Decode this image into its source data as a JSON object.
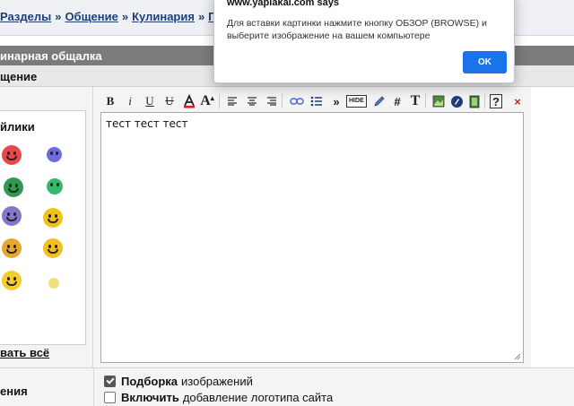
{
  "breadcrumb": [
    {
      "label": "Разделы"
    },
    {
      "label": "Общение"
    },
    {
      "label": "Кулинария"
    },
    {
      "label": "Г"
    }
  ],
  "breadcrumb_separator": "»",
  "forum_title": "инарная общалка",
  "section_title": "щение",
  "smiley_panel": {
    "title": "йлики",
    "show_all": "вать всё"
  },
  "editor": {
    "toolbar": {
      "bold": "B",
      "italic": "i",
      "underline": "U",
      "strike": "U",
      "font_size": "A",
      "hide": "HIDE",
      "hash": "#",
      "text_t": "T",
      "help": "?",
      "close": "×",
      "quote": "»"
    },
    "text": "тест тест тест"
  },
  "options": {
    "left_label": "ения",
    "items": [
      {
        "bold": "Подборка",
        "rest": "изображений",
        "checked": true
      },
      {
        "bold": "Включить",
        "rest": "добавление логотипа сайта",
        "checked": false
      }
    ]
  },
  "dialog": {
    "title": "www.yaplakal.com says",
    "message": "Для вставки картинки нажмите кнопку ОБЗОР (BROWSE) и выберите изображение на вашем компьютере",
    "ok_label": "OK"
  },
  "colors": {
    "link": "#1d3f7a",
    "title_bar": "#7b7b7b",
    "dialog_button": "#1a73e8"
  }
}
